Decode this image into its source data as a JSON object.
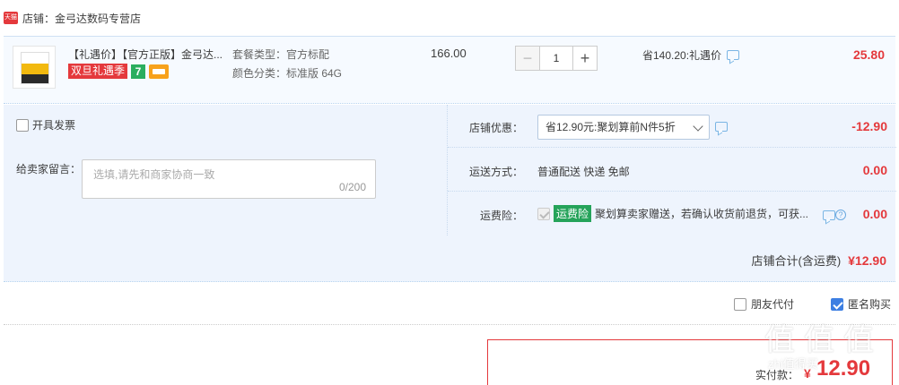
{
  "shop": {
    "badge": "天猫",
    "name": "店铺：金弓达数码专营店"
  },
  "item": {
    "title": "【礼遇价】【官方正版】金弓达...",
    "tags": {
      "promo": "双旦礼遇季",
      "seven": "7"
    },
    "spec_type": "套餐类型：官方标配",
    "spec_color": "颜色分类：标准版 64G",
    "unit_price": "166.00",
    "quantity": "1",
    "qty_minus": "−",
    "qty_plus": "+",
    "discount_note": "省140.20:礼遇价",
    "total": "25.80"
  },
  "options": {
    "invoice_label": "开具发票",
    "remark_label": "给卖家留言：",
    "remark_placeholder": "选填,请先和商家协商一致",
    "remark_count": "0/200",
    "shop_discount_label": "店铺优惠：",
    "shop_discount_value": "省12.90元:聚划算前N件5折",
    "shop_discount_amount": "-12.90",
    "shipping_label": "运送方式：",
    "shipping_value": "普通配送 快递 免邮",
    "shipping_amount": "0.00",
    "insurance_label": "运费险：",
    "insurance_tag": "运费险",
    "insurance_text": "聚划算卖家赠送，若确认收货前退货，可获...",
    "insurance_help": "?",
    "insurance_amount": "0.00"
  },
  "shop_total": {
    "label": "店铺合计(含运费)",
    "value": "¥12.90"
  },
  "checkout": {
    "friend_pay": "朋友代付",
    "anonymous": "匿名购买",
    "pay_label": "实付款：",
    "currency": "¥",
    "pay_amount": "12.90"
  },
  "watermark": {
    "glyphs": [
      "值",
      "值",
      "值"
    ],
    "url": "zhi值得买"
  },
  "colors": {
    "accent_red": "#e4393c",
    "row_bg": "#f6faff",
    "options_bg": "#eef4fd",
    "insurance_green": "#25a35a",
    "check_blue": "#3d7fe2"
  },
  "icons": [
    "tmall-badge-icon",
    "message-icon",
    "chevron-down-icon",
    "help-icon",
    "checkbox-icon"
  ]
}
